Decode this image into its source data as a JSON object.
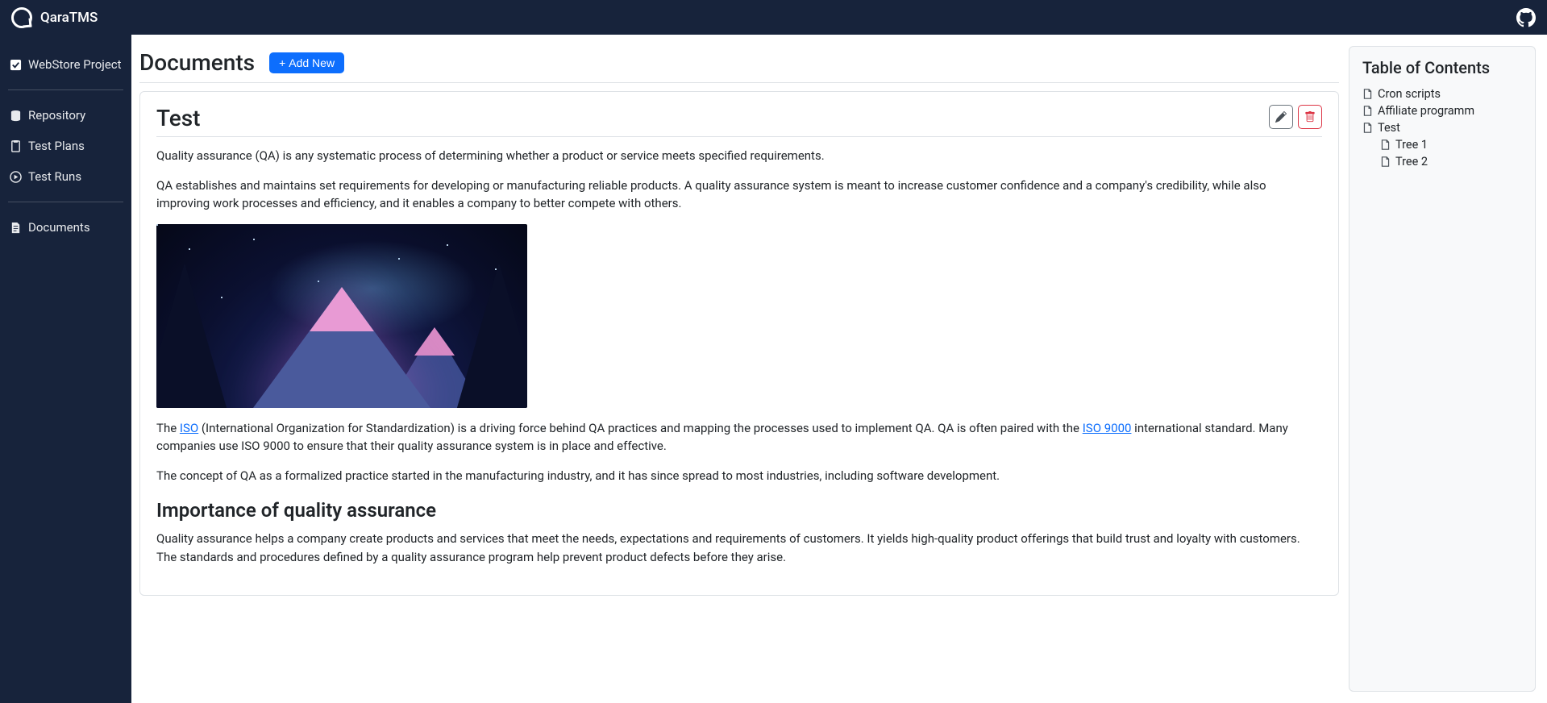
{
  "app": {
    "name": "QaraTMS"
  },
  "sidebar": {
    "project": "WebStore Project",
    "items": [
      {
        "label": "Repository",
        "icon": "database-icon"
      },
      {
        "label": "Test Plans",
        "icon": "clipboard-icon"
      },
      {
        "label": "Test Runs",
        "icon": "play-circle-icon"
      }
    ],
    "documents_label": "Documents"
  },
  "page": {
    "title": "Documents",
    "add_button": "Add New"
  },
  "doc": {
    "title": "Test",
    "p1": "Quality assurance (QA) is any systematic process of determining whether a product or service meets specified requirements.",
    "p2": "QA establishes and maintains set requirements for developing or manufacturing reliable products. A quality assurance system is meant to increase customer confidence and a company's credibility, while also improving work processes and efficiency, and it enables a company to better compete with others.",
    "p3_pre": "The ",
    "p3_link1": "ISO",
    "p3_mid": " (International Organization for Standardization) is a driving force behind QA practices and mapping the processes used to implement QA. QA is often paired with the ",
    "p3_link2": "ISO 9000",
    "p3_post": " international standard. Many companies use ISO 9000 to ensure that their quality assurance system is in place and effective.",
    "p4": "The concept of QA as a formalized practice started in the manufacturing industry, and it has since spread to most industries, including software development.",
    "h2": "Importance of quality assurance",
    "p5": "Quality assurance helps a company create products and services that meet the needs, expectations and requirements of customers. It yields high-quality product offerings that build trust and loyalty with customers. The standards and procedures defined by a quality assurance program help prevent product defects before they arise."
  },
  "toc": {
    "title": "Table of Contents",
    "items": [
      {
        "label": "Cron scripts",
        "nested": false
      },
      {
        "label": "Affiliate programm",
        "nested": false
      },
      {
        "label": "Test",
        "nested": false
      },
      {
        "label": "Tree 1",
        "nested": true
      },
      {
        "label": "Tree 2",
        "nested": true
      }
    ]
  }
}
